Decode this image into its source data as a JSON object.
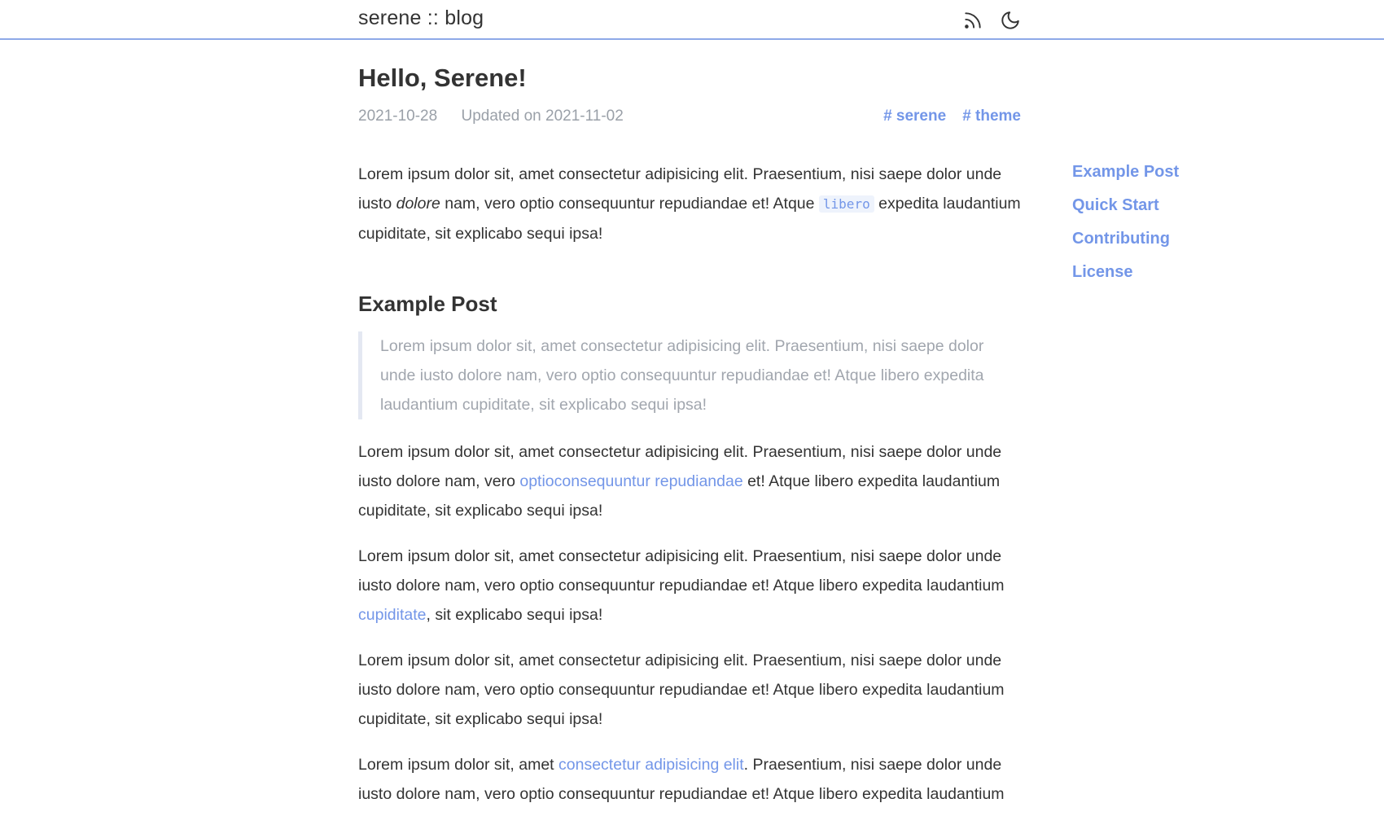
{
  "header": {
    "brand": "serene :: blog",
    "icons": [
      "rss-icon",
      "moon-icon"
    ]
  },
  "post": {
    "title": "Hello, Serene!",
    "date": "2021-10-28",
    "updated": "Updated on 2021-11-02",
    "tags": [
      "# serene",
      "# theme"
    ]
  },
  "content": {
    "p1": {
      "a": "Lorem ipsum dolor sit, amet consectetur adipisicing elit. Praesentium, nisi saepe dolor unde iusto ",
      "em": "dolore",
      "b": " nam, vero optio consequuntur repudiandae et! Atque ",
      "code": "libero",
      "c": " expedita laudantium cupiditate, sit explicabo sequi ipsa!"
    },
    "h2": "Example Post",
    "quote": "Lorem ipsum dolor sit, amet consectetur adipisicing elit. Praesentium, nisi saepe dolor unde iusto dolore nam, vero optio consequuntur repudiandae et! Atque libero expedita laudantium cupiditate, sit explicabo sequi ipsa!",
    "p2": {
      "a": "Lorem ipsum dolor sit, amet consectetur adipisicing elit. Praesentium, nisi saepe dolor unde iusto dolore nam, vero ",
      "link": "optioconsequuntur repudiandae",
      "b": " et! Atque libero expedita laudantium cupiditate, sit explicabo sequi ipsa!"
    },
    "p3": {
      "a": "Lorem ipsum dolor sit, amet consectetur adipisicing elit. Praesentium, nisi saepe dolor unde iusto dolore nam, vero optio consequuntur repudiandae et! Atque libero expedita laudantium ",
      "link": "cupiditate",
      "b": ", sit explicabo sequi ipsa!"
    },
    "p4": "Lorem ipsum dolor sit, amet consectetur adipisicing elit. Praesentium, nisi saepe dolor unde iusto dolore nam, vero optio consequuntur repudiandae et! Atque libero expedita laudantium cupiditate, sit explicabo sequi ipsa!",
    "p5": {
      "a": "Lorem ipsum dolor sit, amet ",
      "link": "consectetur adipisicing elit",
      "b": ". Praesentium, nisi saepe dolor unde iusto dolore nam, vero optio consequuntur repudiandae et! Atque libero expedita laudantium"
    }
  },
  "toc": {
    "items": [
      "Example Post",
      "Quick Start",
      "Contributing",
      "License"
    ]
  },
  "colors": {
    "accent": "#7396e8",
    "header_border": "#8ea9e8",
    "muted": "#9aa0a8"
  }
}
